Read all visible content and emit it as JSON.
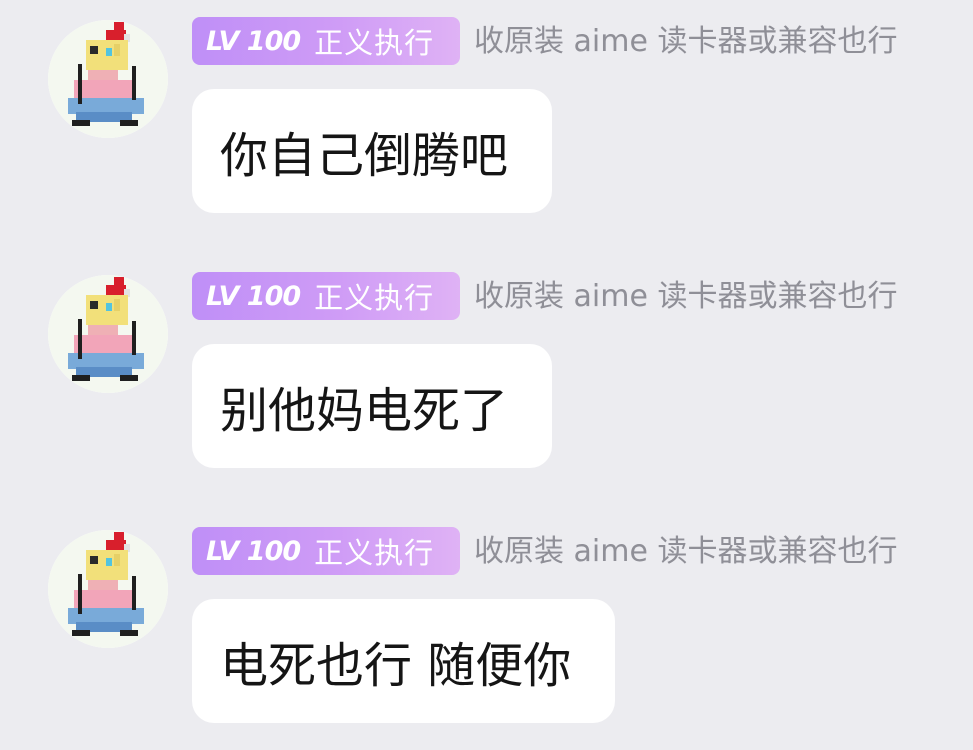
{
  "messages": [
    {
      "sender": {
        "level": "LV 100",
        "title": "正义执行",
        "name": "收原装 aime 读卡器或兼容也行",
        "avatar": "pixel-character-avatar"
      },
      "text": "你自己倒腾吧"
    },
    {
      "sender": {
        "level": "LV 100",
        "title": "正义执行",
        "name": "收原装 aime 读卡器或兼容也行",
        "avatar": "pixel-character-avatar"
      },
      "text": "别他妈电死了"
    },
    {
      "sender": {
        "level": "LV 100",
        "title": "正义执行",
        "name": "收原装 aime 读卡器或兼容也行",
        "avatar": "pixel-character-avatar"
      },
      "text": "电死也行 随便你"
    }
  ],
  "colors": {
    "background": "#ececf0",
    "bubble": "#ffffff",
    "badge_start": "#bf8ff7",
    "badge_end": "#dfb2f5",
    "name_text": "#8f8f97",
    "message_text": "#151515"
  }
}
